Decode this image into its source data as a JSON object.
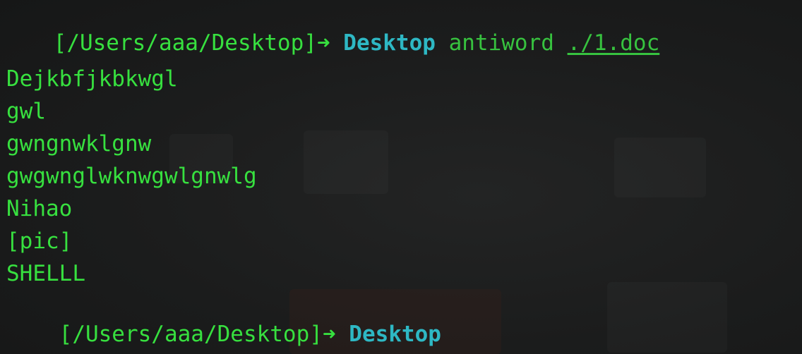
{
  "terminal": {
    "prompt_1": {
      "path": "[/Users/aaa/Desktop]",
      "arrow": "➜",
      "dir": "Desktop",
      "command": "antiword",
      "argument": "./1.doc"
    },
    "output_lines": [
      "Dejkbfjkbkwgl",
      "gwl",
      "gwngnwklgnw",
      "gwgwnglwknwgwlgnwlg",
      "Nihao",
      "[pic]",
      "SHELLL"
    ],
    "prompt_2": {
      "path": "[/Users/aaa/Desktop]",
      "arrow": "➜",
      "dir": "Desktop"
    }
  },
  "colors": {
    "background": "#191a1a",
    "text_green": "#37e03f",
    "dir_cyan": "#2eb8c4",
    "command_green": "#37c23f"
  }
}
